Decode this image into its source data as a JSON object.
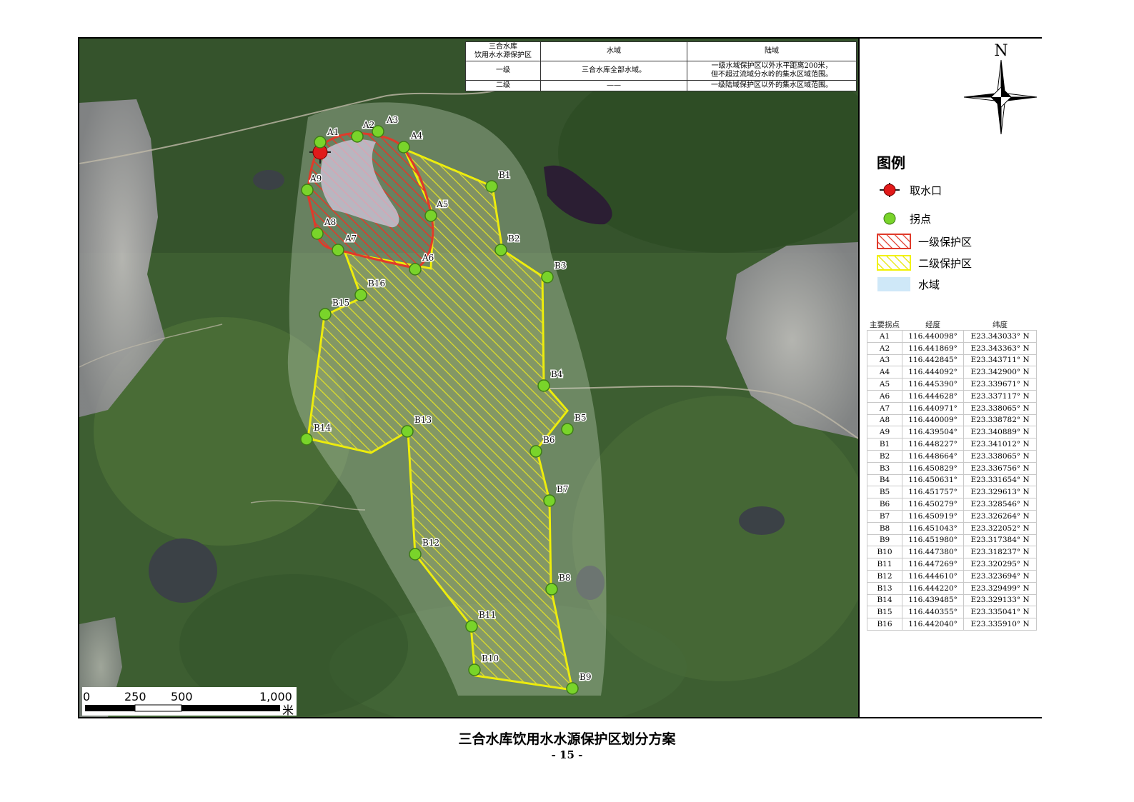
{
  "table": {
    "header": [
      "三合水库\n饮用水水源保护区",
      "水域",
      "陆域"
    ],
    "rows": [
      [
        "一级",
        "三合水库全部水域。",
        "一级水域保护区以外水平距离200米，\n但不超过流域分水岭的集水区域范围。"
      ],
      [
        "二级",
        "——",
        "一级陆域保护区以外的集水区域范围。"
      ]
    ]
  },
  "north_label": "N",
  "legend": {
    "title": "图例",
    "items": [
      {
        "label": "取水口",
        "icon": "intake-icon"
      },
      {
        "label": "拐点",
        "icon": "vertex-icon"
      },
      {
        "label": "一级保护区",
        "icon": "level1-hatch-icon",
        "color": "#e03a2a"
      },
      {
        "label": "二级保护区",
        "icon": "level2-hatch-icon",
        "color": "#f2f200"
      },
      {
        "label": "水域",
        "icon": "water-icon",
        "color": "#cfe8f8"
      }
    ]
  },
  "coord_table": {
    "headers": [
      "主要拐点",
      "经度",
      "纬度"
    ],
    "rows": [
      [
        "A1",
        "116.440098°",
        "E23.343033° N"
      ],
      [
        "A2",
        "116.441869°",
        "E23.343363° N"
      ],
      [
        "A3",
        "116.442845°",
        "E23.343711° N"
      ],
      [
        "A4",
        "116.444092°",
        "E23.342900° N"
      ],
      [
        "A5",
        "116.445390°",
        "E23.339671° N"
      ],
      [
        "A6",
        "116.444628°",
        "E23.337117° N"
      ],
      [
        "A7",
        "116.440971°",
        "E23.338065° N"
      ],
      [
        "A8",
        "116.440009°",
        "E23.338782° N"
      ],
      [
        "A9",
        "116.439504°",
        "E23.340889° N"
      ],
      [
        "B1",
        "116.448227°",
        "E23.341012° N"
      ],
      [
        "B2",
        "116.448664°",
        "E23.338065° N"
      ],
      [
        "B3",
        "116.450829°",
        "E23.336756° N"
      ],
      [
        "B4",
        "116.450631°",
        "E23.331654° N"
      ],
      [
        "B5",
        "116.451757°",
        "E23.329613° N"
      ],
      [
        "B6",
        "116.450279°",
        "E23.328546° N"
      ],
      [
        "B7",
        "116.450919°",
        "E23.326264° N"
      ],
      [
        "B8",
        "116.451043°",
        "E23.322052° N"
      ],
      [
        "B9",
        "116.451980°",
        "E23.317384° N"
      ],
      [
        "B10",
        "116.447380°",
        "E23.318237° N"
      ],
      [
        "B11",
        "116.447269°",
        "E23.320295° N"
      ],
      [
        "B12",
        "116.444610°",
        "E23.323694° N"
      ],
      [
        "B13",
        "116.444220°",
        "E23.329499° N"
      ],
      [
        "B14",
        "116.439485°",
        "E23.329133° N"
      ],
      [
        "B15",
        "116.440355°",
        "E23.335041° N"
      ],
      [
        "B16",
        "116.442040°",
        "E23.335910° N"
      ]
    ]
  },
  "scale_bar": {
    "ticks": [
      "0",
      "250",
      "500",
      "1,000"
    ],
    "unit": "米"
  },
  "caption": "三合水库饮用水水源保护区划分方案",
  "page_number": "- 15 -"
}
